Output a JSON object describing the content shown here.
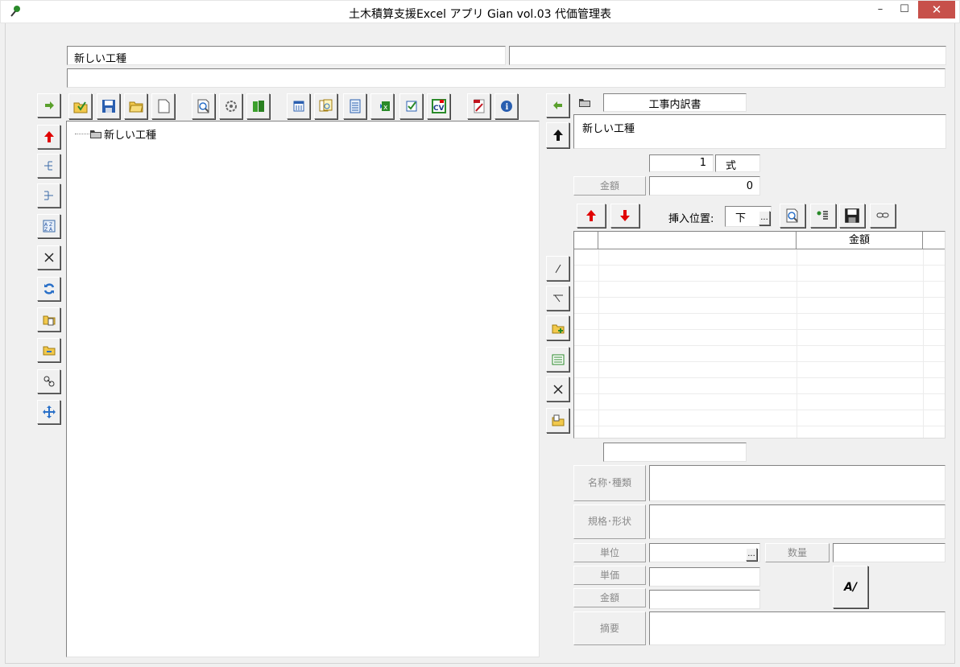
{
  "window": {
    "title": "土木積算支援Excel アプリ Gian vol.03 代価管理表",
    "minimize": "–",
    "maximize": "☐",
    "close": "✕"
  },
  "header": {
    "kousyu_name": "新しい工種",
    "kousyu_sub": "",
    "memo": ""
  },
  "tree": {
    "root_label": "新しい工種"
  },
  "detail_panel": {
    "doc_label": "工事内訳書",
    "doc_name": "新しい工種",
    "quantity": "1",
    "unit": "式",
    "amount_label": "金額",
    "amount_value": "0",
    "insert_label": "挿入位置:",
    "insert_value": "下",
    "insert_dots": "...",
    "grid_columns": [
      "",
      "",
      "金額",
      ""
    ],
    "grid_rows": 11,
    "under_grid_value": ""
  },
  "form": {
    "name_label": "名称･種類",
    "spec_label": "規格･形状",
    "unit_label": "単位",
    "unit_dots": "...",
    "count_label": "数量",
    "price_label": "単価",
    "sum_label": "金額",
    "memo_label": "摘要",
    "auto_button": "A/",
    "name_value": "",
    "spec_value": "",
    "unit_value": "",
    "count_value": "",
    "price_value": "",
    "sum_value": "",
    "memo_value": ""
  },
  "colors": {
    "accent_red": "#e00000",
    "close_red": "#c7504a",
    "window_bg": "#f0f0f0"
  }
}
